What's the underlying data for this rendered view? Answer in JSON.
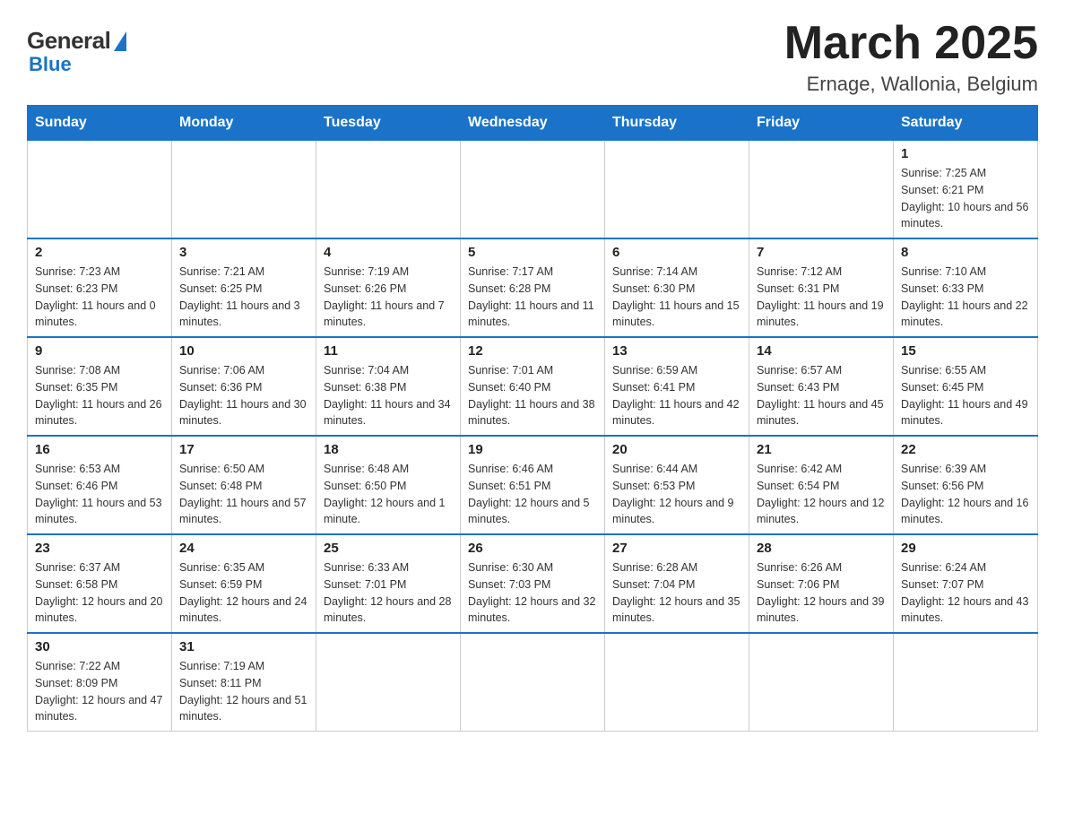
{
  "header": {
    "logo_general": "General",
    "logo_blue": "Blue",
    "month_year": "March 2025",
    "location": "Ernage, Wallonia, Belgium"
  },
  "days_of_week": [
    "Sunday",
    "Monday",
    "Tuesday",
    "Wednesday",
    "Thursday",
    "Friday",
    "Saturday"
  ],
  "weeks": [
    [
      {
        "day": "",
        "info": ""
      },
      {
        "day": "",
        "info": ""
      },
      {
        "day": "",
        "info": ""
      },
      {
        "day": "",
        "info": ""
      },
      {
        "day": "",
        "info": ""
      },
      {
        "day": "",
        "info": ""
      },
      {
        "day": "1",
        "info": "Sunrise: 7:25 AM\nSunset: 6:21 PM\nDaylight: 10 hours and 56 minutes."
      }
    ],
    [
      {
        "day": "2",
        "info": "Sunrise: 7:23 AM\nSunset: 6:23 PM\nDaylight: 11 hours and 0 minutes."
      },
      {
        "day": "3",
        "info": "Sunrise: 7:21 AM\nSunset: 6:25 PM\nDaylight: 11 hours and 3 minutes."
      },
      {
        "day": "4",
        "info": "Sunrise: 7:19 AM\nSunset: 6:26 PM\nDaylight: 11 hours and 7 minutes."
      },
      {
        "day": "5",
        "info": "Sunrise: 7:17 AM\nSunset: 6:28 PM\nDaylight: 11 hours and 11 minutes."
      },
      {
        "day": "6",
        "info": "Sunrise: 7:14 AM\nSunset: 6:30 PM\nDaylight: 11 hours and 15 minutes."
      },
      {
        "day": "7",
        "info": "Sunrise: 7:12 AM\nSunset: 6:31 PM\nDaylight: 11 hours and 19 minutes."
      },
      {
        "day": "8",
        "info": "Sunrise: 7:10 AM\nSunset: 6:33 PM\nDaylight: 11 hours and 22 minutes."
      }
    ],
    [
      {
        "day": "9",
        "info": "Sunrise: 7:08 AM\nSunset: 6:35 PM\nDaylight: 11 hours and 26 minutes."
      },
      {
        "day": "10",
        "info": "Sunrise: 7:06 AM\nSunset: 6:36 PM\nDaylight: 11 hours and 30 minutes."
      },
      {
        "day": "11",
        "info": "Sunrise: 7:04 AM\nSunset: 6:38 PM\nDaylight: 11 hours and 34 minutes."
      },
      {
        "day": "12",
        "info": "Sunrise: 7:01 AM\nSunset: 6:40 PM\nDaylight: 11 hours and 38 minutes."
      },
      {
        "day": "13",
        "info": "Sunrise: 6:59 AM\nSunset: 6:41 PM\nDaylight: 11 hours and 42 minutes."
      },
      {
        "day": "14",
        "info": "Sunrise: 6:57 AM\nSunset: 6:43 PM\nDaylight: 11 hours and 45 minutes."
      },
      {
        "day": "15",
        "info": "Sunrise: 6:55 AM\nSunset: 6:45 PM\nDaylight: 11 hours and 49 minutes."
      }
    ],
    [
      {
        "day": "16",
        "info": "Sunrise: 6:53 AM\nSunset: 6:46 PM\nDaylight: 11 hours and 53 minutes."
      },
      {
        "day": "17",
        "info": "Sunrise: 6:50 AM\nSunset: 6:48 PM\nDaylight: 11 hours and 57 minutes."
      },
      {
        "day": "18",
        "info": "Sunrise: 6:48 AM\nSunset: 6:50 PM\nDaylight: 12 hours and 1 minute."
      },
      {
        "day": "19",
        "info": "Sunrise: 6:46 AM\nSunset: 6:51 PM\nDaylight: 12 hours and 5 minutes."
      },
      {
        "day": "20",
        "info": "Sunrise: 6:44 AM\nSunset: 6:53 PM\nDaylight: 12 hours and 9 minutes."
      },
      {
        "day": "21",
        "info": "Sunrise: 6:42 AM\nSunset: 6:54 PM\nDaylight: 12 hours and 12 minutes."
      },
      {
        "day": "22",
        "info": "Sunrise: 6:39 AM\nSunset: 6:56 PM\nDaylight: 12 hours and 16 minutes."
      }
    ],
    [
      {
        "day": "23",
        "info": "Sunrise: 6:37 AM\nSunset: 6:58 PM\nDaylight: 12 hours and 20 minutes."
      },
      {
        "day": "24",
        "info": "Sunrise: 6:35 AM\nSunset: 6:59 PM\nDaylight: 12 hours and 24 minutes."
      },
      {
        "day": "25",
        "info": "Sunrise: 6:33 AM\nSunset: 7:01 PM\nDaylight: 12 hours and 28 minutes."
      },
      {
        "day": "26",
        "info": "Sunrise: 6:30 AM\nSunset: 7:03 PM\nDaylight: 12 hours and 32 minutes."
      },
      {
        "day": "27",
        "info": "Sunrise: 6:28 AM\nSunset: 7:04 PM\nDaylight: 12 hours and 35 minutes."
      },
      {
        "day": "28",
        "info": "Sunrise: 6:26 AM\nSunset: 7:06 PM\nDaylight: 12 hours and 39 minutes."
      },
      {
        "day": "29",
        "info": "Sunrise: 6:24 AM\nSunset: 7:07 PM\nDaylight: 12 hours and 43 minutes."
      }
    ],
    [
      {
        "day": "30",
        "info": "Sunrise: 7:22 AM\nSunset: 8:09 PM\nDaylight: 12 hours and 47 minutes."
      },
      {
        "day": "31",
        "info": "Sunrise: 7:19 AM\nSunset: 8:11 PM\nDaylight: 12 hours and 51 minutes."
      },
      {
        "day": "",
        "info": ""
      },
      {
        "day": "",
        "info": ""
      },
      {
        "day": "",
        "info": ""
      },
      {
        "day": "",
        "info": ""
      },
      {
        "day": "",
        "info": ""
      }
    ]
  ]
}
